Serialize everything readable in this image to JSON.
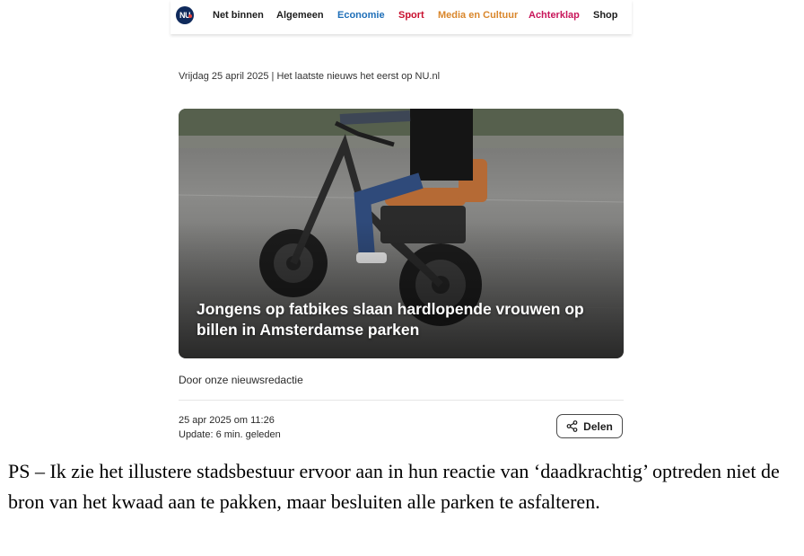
{
  "nav": {
    "logo_text": "NU",
    "items": [
      {
        "label": "Net binnen",
        "color": "#1d1d1d"
      },
      {
        "label": "Algemeen",
        "color": "#1d1d1d"
      },
      {
        "label": "Economie",
        "color": "#1f6fb8"
      },
      {
        "label": "Sport",
        "color": "#c8102e"
      },
      {
        "label": "Media en Cultuur",
        "color": "#d9862b"
      },
      {
        "label": "Achterklap",
        "color": "#c8165a"
      },
      {
        "label": "Shop",
        "color": "#1d1d1d"
      }
    ]
  },
  "dateline": "Vrijdag 25 april 2025 | Het laatste nieuws het eerst op NU.nl",
  "article": {
    "image_subject": "fatbike",
    "title": "Jongens op fatbikes slaan hardlopende vrouwen op billen in Amsterdamse parken",
    "byline": "Door onze nieuwsredactie",
    "published": "25 apr 2025 om 11:26",
    "updated": "Update: 6 min. geleden",
    "share_label": "Delen",
    "share_icon": "share-icon"
  },
  "comment": "PS – Ik zie het illustere stadsbestuur ervoor aan in hun reactie van ‘daadkrachtig’ optreden niet de bron van het kwaad aan te pakken, maar besluiten alle parken te asfalteren."
}
